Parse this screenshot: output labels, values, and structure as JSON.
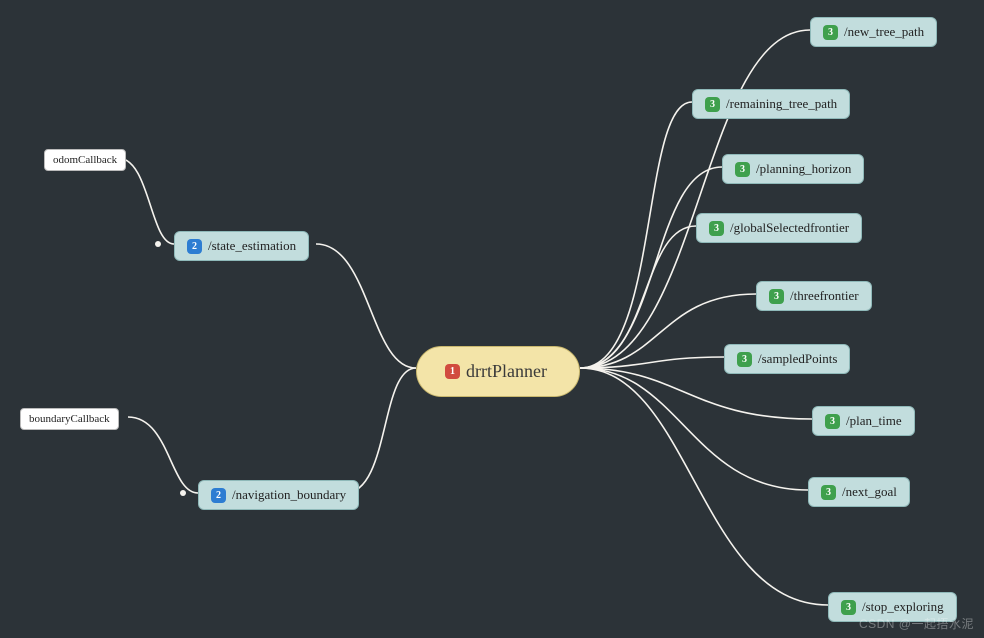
{
  "center": {
    "badge": "1",
    "label": "drrtPlanner"
  },
  "left": {
    "inputs": [
      {
        "id": "state_estimation",
        "badge": "2",
        "label": "/state_estimation",
        "callback": {
          "label": "odomCallback"
        }
      },
      {
        "id": "navigation_boundary",
        "badge": "2",
        "label": "/navigation_boundary",
        "callback": {
          "label": "boundaryCallback"
        }
      }
    ]
  },
  "right": {
    "outputs": [
      {
        "id": "new_tree_path",
        "badge": "3",
        "label": "/new_tree_path"
      },
      {
        "id": "remaining_tree_path",
        "badge": "3",
        "label": "/remaining_tree_path"
      },
      {
        "id": "planning_horizon",
        "badge": "3",
        "label": "/planning_horizon"
      },
      {
        "id": "globalSelectedfrontier",
        "badge": "3",
        "label": "/globalSelectedfrontier"
      },
      {
        "id": "threefrontier",
        "badge": "3",
        "label": "/threefrontier"
      },
      {
        "id": "sampledPoints",
        "badge": "3",
        "label": "/sampledPoints"
      },
      {
        "id": "plan_time",
        "badge": "3",
        "label": "/plan_time"
      },
      {
        "id": "next_goal",
        "badge": "3",
        "label": "/next_goal"
      },
      {
        "id": "stop_exploring",
        "badge": "3",
        "label": "/stop_exploring"
      }
    ]
  },
  "watermark": "CSDN @一起捂水泥",
  "colors": {
    "background": "#2c3338",
    "center_fill": "#f3e4a8",
    "topic_fill": "#c2dddd",
    "callback_fill": "#ffffff",
    "edge": "#f5f3ee"
  }
}
